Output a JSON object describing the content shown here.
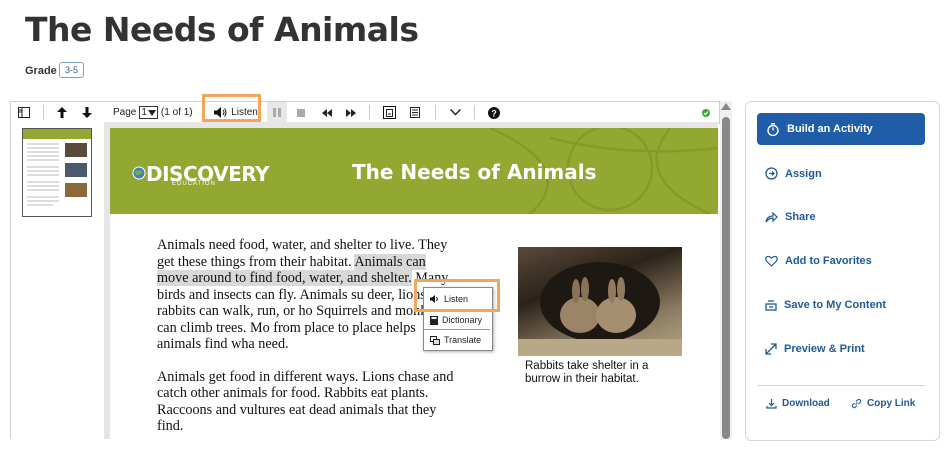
{
  "page": {
    "title": "The Needs of Animals",
    "grade_label": "Grade",
    "grade_value": "3-5"
  },
  "toolbar": {
    "page_label": "Page",
    "page_value": "1",
    "page_count": "(1 of 1)",
    "listen_label": "Listen",
    "status_color": "#3aa53a"
  },
  "document": {
    "logo_text": "DISCOVERY",
    "logo_sub": "EDUCATION",
    "banner_title": "The Needs of Animals",
    "banner_color": "#93a830",
    "p1_a": "Animals need food, water, and shelter to live. They get these things from their habitat. ",
    "p1_hl": "Animals can move around to find food, water, and shelter.",
    "p1_b": " Many birds and insects can fly. Animals su deer, lions, and rabbits can walk, run, or ho Squirrels and monkeys can climb trees. Mo from place to place helps animals find wha need.",
    "p2": "Animals get food in different ways. Lions chase and catch other animals for food. Rabbits eat plants. Raccoons and vultures eat dead animals that they find.",
    "caption": "Rabbits take shelter in a burrow in their habitat."
  },
  "context_menu": {
    "items": [
      "Listen",
      "Dictionary",
      "Translate"
    ]
  },
  "side_panel": {
    "build_label": "Build an Activity",
    "items": [
      "Assign",
      "Share",
      "Add to Favorites",
      "Save to My Content",
      "Preview & Print"
    ],
    "download_label": "Download",
    "copy_link_label": "Copy Link",
    "accent": "#1f5da8"
  }
}
